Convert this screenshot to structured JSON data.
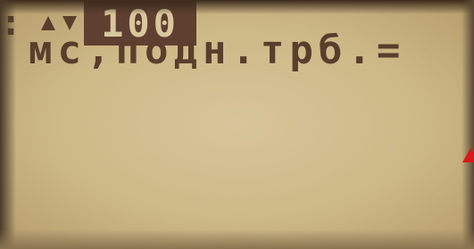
{
  "display": {
    "parameter_label": "мс,подн.трб.=",
    "prefix": ":",
    "value": "100",
    "up_icon": "triangle-up-icon",
    "down_icon": "triangle-down-icon"
  },
  "colors": {
    "lcd_background": "#cdb887",
    "lcd_text": "#5a3e2c",
    "value_highlight": "#5e4030",
    "marker": "#d81a1a"
  }
}
